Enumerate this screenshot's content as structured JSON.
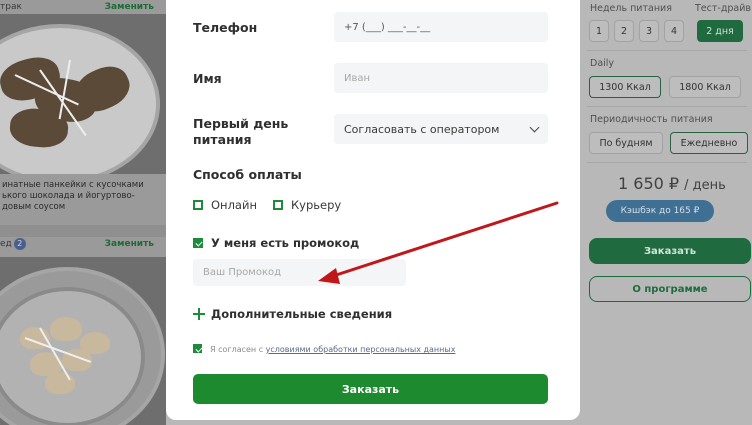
{
  "background_left": {
    "card_a": {
      "meal": "трак",
      "swap": "Заменить",
      "description": "инатные панкейки с кусочками\nького шоколада и йогуртово-\nдовым соусом"
    },
    "card_b": {
      "meal": "ед",
      "badge": "2",
      "swap": "Заменить"
    }
  },
  "background_right": {
    "weeks_label": "Недель питания",
    "weeks": [
      "1",
      "2",
      "3",
      "4"
    ],
    "test_label": "Тест-драйв",
    "test_value": "2 дня",
    "daily_label": "Daily",
    "kcal": [
      "1300 Ккал",
      "1800 Ккал"
    ],
    "periodicity_label": "Периодичность питания",
    "periodicity": [
      "По будням",
      "Ежедневно"
    ],
    "price": "1 650 ₽",
    "price_unit": "/ день",
    "cashback": "Кэшбэк до 165 ₽",
    "order_button": "Заказать",
    "about_button": "О программе"
  },
  "form": {
    "phone_label": "Телефон",
    "phone_value": "+7 (___) ___-__-__",
    "name_label": "Имя",
    "name_placeholder": "Иван",
    "first_day_label": "Первый день питания",
    "first_day_value": "Согласовать с оператором",
    "payment_label": "Способ оплаты",
    "payment_online": "Онлайн",
    "payment_courier": "Курьеру",
    "promo_checkbox": "У меня есть промокод",
    "promo_placeholder": "Ваш Промокод",
    "extra_info": "Дополнительные сведения",
    "agree_prefix": "Я согласен с",
    "agree_link": "условиями обработки персональных данных",
    "submit": "Заказать"
  },
  "colors": {
    "accent_green": "#1e8a2f",
    "arrow_red": "#c0171b"
  }
}
